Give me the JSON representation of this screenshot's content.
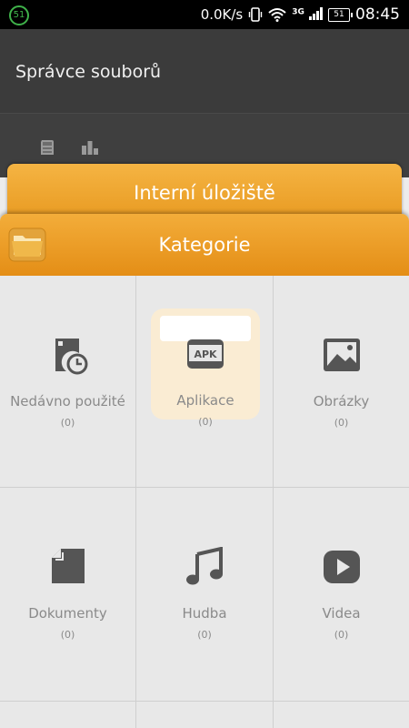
{
  "status_bar": {
    "notification_badge": "51",
    "net_speed": "0.0K/s",
    "network_type": "3G",
    "battery": "51",
    "time": "08:45"
  },
  "app_bar": {
    "title": "Správce souborů"
  },
  "toolbar": {
    "icons": [
      "sd-card-icon",
      "bar-chart-icon"
    ]
  },
  "tabs": {
    "storage_label": "Interní úložiště",
    "categories_label": "Kategorie"
  },
  "categories": [
    {
      "label": "Nedávno použité",
      "count": "(0)",
      "icon": "recent-files-icon"
    },
    {
      "label": "Aplikace",
      "count": "(0)",
      "icon": "apk-icon",
      "selected": true
    },
    {
      "label": "Obrázky",
      "count": "(0)",
      "icon": "image-icon"
    },
    {
      "label": "Dokumenty",
      "count": "(0)",
      "icon": "document-icon"
    },
    {
      "label": "Hudba",
      "count": "(0)",
      "icon": "music-icon"
    },
    {
      "label": "Videa",
      "count": "(0)",
      "icon": "video-icon"
    }
  ],
  "colors": {
    "accent": "#e8961d",
    "appbar": "#3b3b3b",
    "grid_bg": "#e8e8e8",
    "icon": "#555555",
    "label": "#8a8a8a"
  }
}
